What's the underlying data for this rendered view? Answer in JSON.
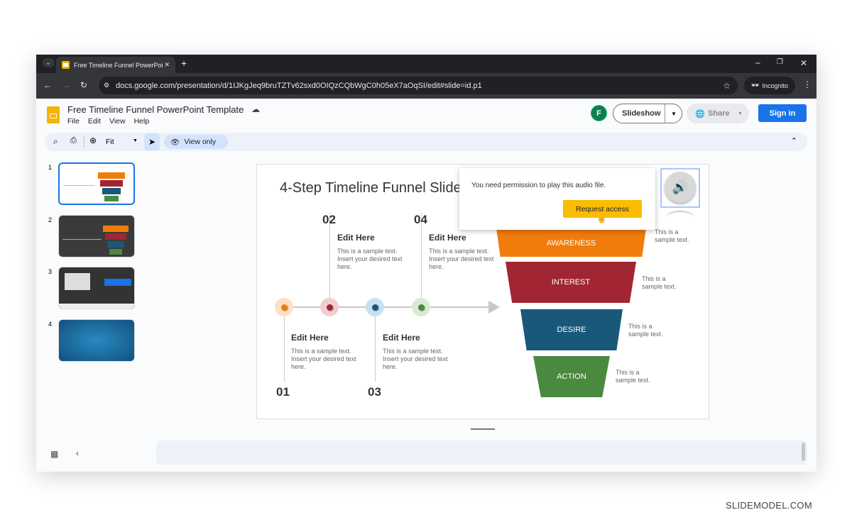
{
  "browser": {
    "tab_title": "Free Timeline Funnel PowerPoi",
    "url": "docs.google.com/presentation/d/1IJKgJeq9bruTZTv62sxd0OIQzCQbWgC0h05eX7aOqSI/edit#slide=id.p1",
    "incognito_label": "Incognito"
  },
  "doc": {
    "title": "Free Timeline Funnel PowerPoint Template",
    "menu": [
      "File",
      "Edit",
      "View",
      "Help"
    ],
    "avatar_letter": "F",
    "slideshow_label": "Slideshow",
    "share_label": "Share",
    "signin_label": "Sign in"
  },
  "toolbar": {
    "zoom_value": "Fit",
    "view_only_label": "View only"
  },
  "thumbnails": [
    {
      "number": "1"
    },
    {
      "number": "2"
    },
    {
      "number": "3"
    },
    {
      "number": "4"
    }
  ],
  "slide": {
    "title": "4-Step Timeline Funnel Slide",
    "steps": [
      {
        "num": "01",
        "heading": "Edit Here",
        "text": "This is a sample text. Insert your desired text here.",
        "color": "#f07c0c"
      },
      {
        "num": "02",
        "heading": "Edit Here",
        "text": "This is a sample text. Insert your desired text here.",
        "color": "#a12533"
      },
      {
        "num": "03",
        "heading": "Edit Here",
        "text": "This is a sample text. Insert your desired text here.",
        "color": "#1a587a"
      },
      {
        "num": "04",
        "heading": "Edit Here",
        "text": "This is a sample text. Insert your desired text here.",
        "color": "#4a8a3e"
      }
    ],
    "funnel": [
      {
        "label": "AWARENESS",
        "text": "This is a sample text.",
        "color": "#f07c0c"
      },
      {
        "label": "INTEREST",
        "text": "This is a sample text.",
        "color": "#a12533"
      },
      {
        "label": "DESIRE",
        "text": "This is a sample text.",
        "color": "#1a587a"
      },
      {
        "label": "ACTION",
        "text": "This is a sample text.",
        "color": "#4a8a3e"
      }
    ]
  },
  "popup": {
    "message": "You need permission to play this audio file.",
    "button_label": "Request access"
  },
  "watermark": "SLIDEMODEL.COM"
}
